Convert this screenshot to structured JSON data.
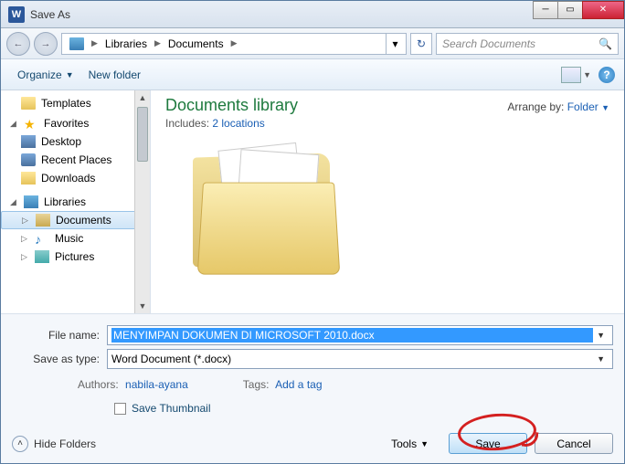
{
  "window": {
    "title": "Save As",
    "appicon": "W"
  },
  "nav": {
    "crumbs": [
      "Libraries",
      "Documents"
    ],
    "search_placeholder": "Search Documents"
  },
  "toolbar": {
    "organize": "Organize",
    "newfolder": "New folder"
  },
  "sidebar": {
    "templates": "Templates",
    "favorites": "Favorites",
    "desktop": "Desktop",
    "recent": "Recent Places",
    "downloads": "Downloads",
    "libraries": "Libraries",
    "documents": "Documents",
    "music": "Music",
    "pictures": "Pictures"
  },
  "content": {
    "title": "Documents library",
    "includes_label": "Includes:",
    "includes_link": "2 locations",
    "arrange_label": "Arrange by:",
    "arrange_value": "Folder"
  },
  "form": {
    "filename_label": "File name:",
    "filename_value": "MENYIMPAN DOKUMEN DI MICROSOFT 2010.docx",
    "type_label": "Save as type:",
    "type_value": "Word Document (*.docx)",
    "authors_label": "Authors:",
    "authors_value": "nabila-ayana",
    "tags_label": "Tags:",
    "tags_value": "Add a tag",
    "save_thumbnail": "Save Thumbnail"
  },
  "footer": {
    "hide": "Hide Folders",
    "tools": "Tools",
    "save": "Save",
    "cancel": "Cancel"
  }
}
